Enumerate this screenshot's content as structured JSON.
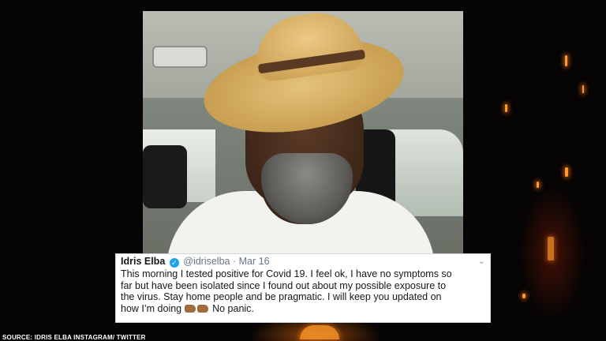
{
  "tweet": {
    "name": "Idris Elba",
    "handle": "@idriselba",
    "separator": "·",
    "date": "Mar 16",
    "lines": [
      "This morning I tested positive for Covid 19. I feel ok, I have no symptoms so",
      "far but have been isolated since I found out about my possible exposure to",
      "the virus.  Stay home people and be pragmatic. I will keep you updated on"
    ],
    "last_line_start": "how I’m doing",
    "last_line_end": "No panic.",
    "emoji": [
      "fist-icon",
      "fist-icon"
    ],
    "verified_icon": "checkmark-badge-icon",
    "menu_icon": "chevron-down-icon"
  },
  "caption": "SOURCE: IDRIS ELBA INSTAGRAM/ TWITTER",
  "colors": {
    "verified": "#1da1f2",
    "tweet_text": "#14171a",
    "tweet_meta": "#657786",
    "background": "#060404",
    "ember": "#ff9a2a"
  }
}
